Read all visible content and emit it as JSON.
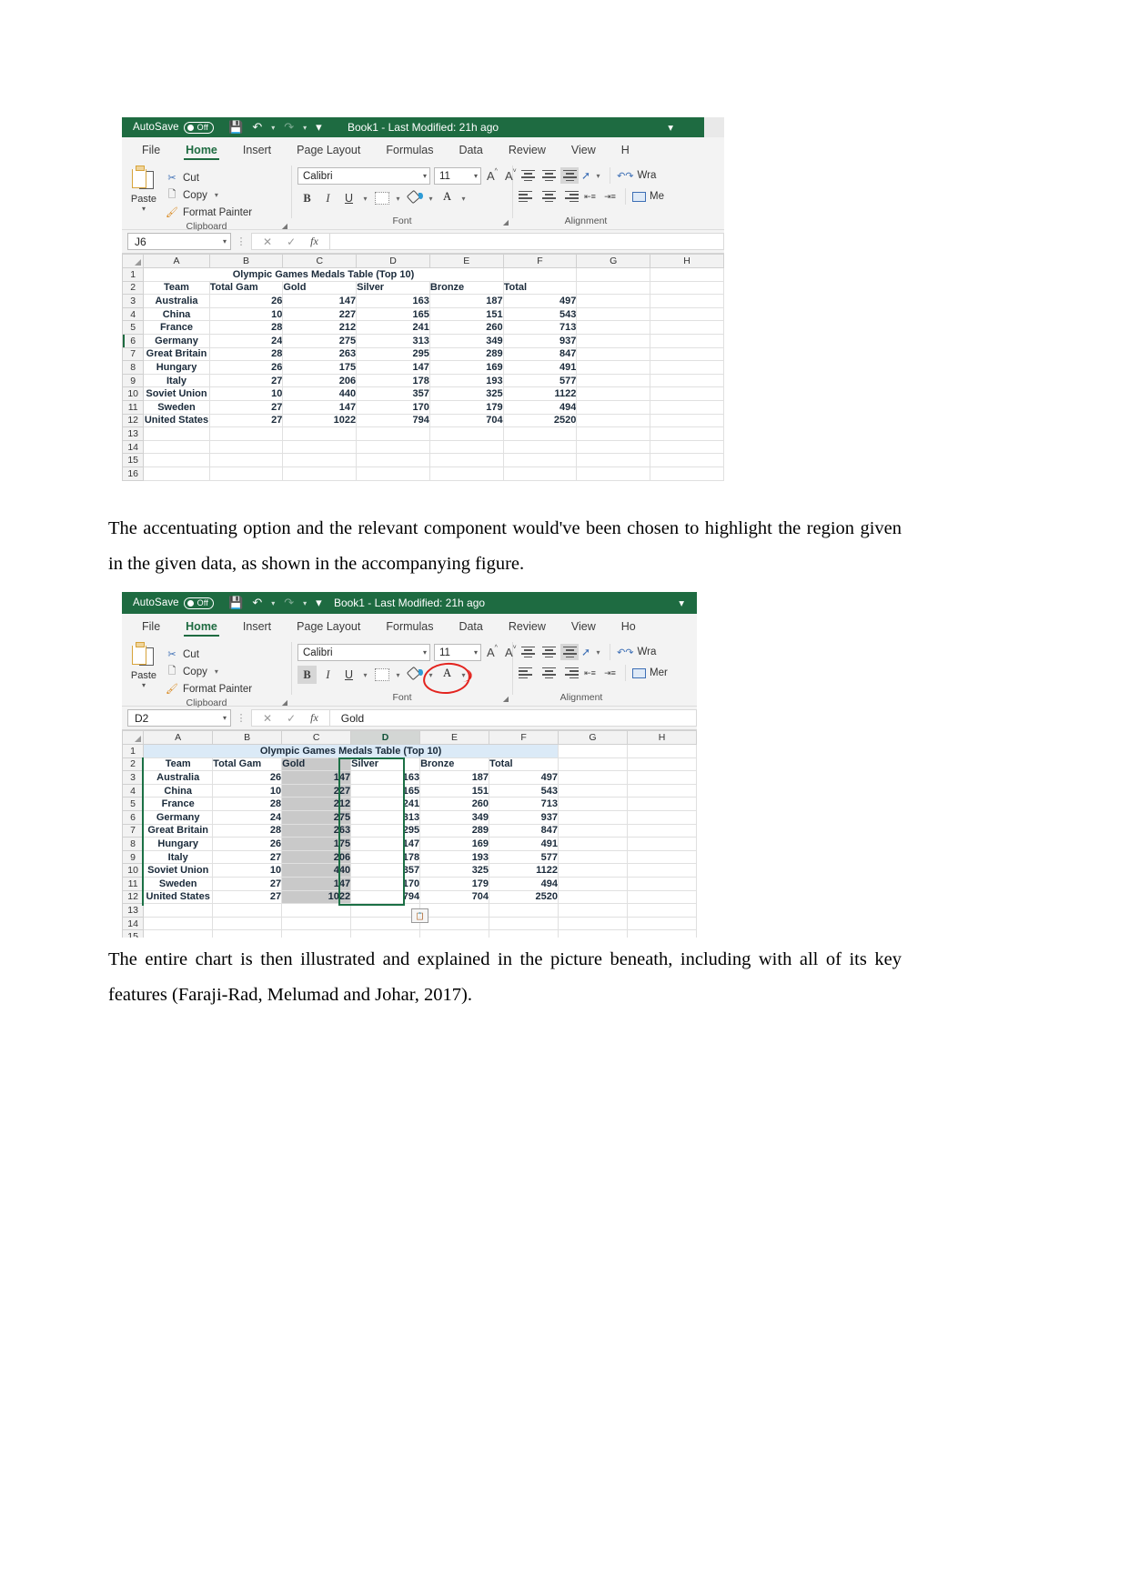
{
  "document": {
    "paragraph_1": "The accentuating option and the relevant component would've been chosen to highlight the region given in the given data, as shown in the accompanying figure.",
    "paragraph_2": "The entire chart is then illustrated and explained in the picture beneath, including with all of its key features (Faraji-Rad, Melumad and Johar, 2017)."
  },
  "excel": {
    "titlebar": {
      "autosave_label": "AutoSave",
      "autosave_state": "Off",
      "document_title": "Book1  -  Last Modified: 21h ago",
      "save_icon": "save-icon",
      "undo_icon": "undo-icon",
      "redo_icon": "redo-icon",
      "customize_icon": "customize-quick-access-icon"
    },
    "tabs": [
      {
        "label": "File",
        "active": false
      },
      {
        "label": "Home",
        "active": true
      },
      {
        "label": "Insert",
        "active": false
      },
      {
        "label": "Page Layout",
        "active": false
      },
      {
        "label": "Formulas",
        "active": false
      },
      {
        "label": "Data",
        "active": false
      },
      {
        "label": "Review",
        "active": false
      },
      {
        "label": "View",
        "active": false
      },
      {
        "label": "H",
        "active": false
      }
    ],
    "tabs_2": [
      {
        "label": "File",
        "active": false
      },
      {
        "label": "Home",
        "active": true
      },
      {
        "label": "Insert",
        "active": false
      },
      {
        "label": "Page Layout",
        "active": false
      },
      {
        "label": "Formulas",
        "active": false
      },
      {
        "label": "Data",
        "active": false
      },
      {
        "label": "Review",
        "active": false
      },
      {
        "label": "View",
        "active": false
      },
      {
        "label": "Ho",
        "active": false
      }
    ],
    "ribbon": {
      "clipboard": {
        "group_label": "Clipboard",
        "paste_label": "Paste",
        "cut_label": "Cut",
        "copy_label": "Copy",
        "format_painter_label": "Format Painter"
      },
      "font": {
        "group_label": "Font",
        "font_name": "Calibri",
        "font_size": "11",
        "increase_font_label": "A",
        "decrease_font_label": "A",
        "bold_label": "B",
        "italic_label": "I",
        "underline_label": "U",
        "borders_name": "borders-icon",
        "fill_color_name": "fill-color-icon",
        "font_color_label": "A",
        "font_color_hex": "#e11b22"
      },
      "alignment": {
        "group_label": "Alignment",
        "wrap_text_label": "Wra",
        "merge_label": "Me",
        "merge_label_2": "Mer",
        "wrap_text_label_2": "Wra",
        "orientation_name": "orientation-icon"
      }
    },
    "formula_bar_1": {
      "name_box": "J6",
      "cancel_icon": "cancel-icon",
      "enter_icon": "confirm-icon",
      "fx_label": "fx",
      "formula_value": ""
    },
    "formula_bar_2": {
      "name_box": "D2",
      "cancel_icon": "cancel-icon",
      "enter_icon": "confirm-icon",
      "fx_label": "fx",
      "formula_value": "Gold"
    },
    "sheet": {
      "column_headers": [
        "A",
        "B",
        "C",
        "D",
        "E",
        "F",
        "G",
        "H"
      ],
      "selected_column": "D",
      "title_row": "Olympic Games Medals Table (Top 10)",
      "header_row": [
        "Team",
        "Total Gam",
        "Gold",
        "Silver",
        "Bronze",
        "Total"
      ],
      "rows": [
        {
          "row": "3",
          "team": "Australia",
          "games": "26",
          "gold": "147",
          "silver": "163",
          "bronze": "187",
          "total": "497"
        },
        {
          "row": "4",
          "team": "China",
          "games": "10",
          "gold": "227",
          "silver": "165",
          "bronze": "151",
          "total": "543"
        },
        {
          "row": "5",
          "team": "France",
          "games": "28",
          "gold": "212",
          "silver": "241",
          "bronze": "260",
          "total": "713"
        },
        {
          "row": "6",
          "team": "Germany",
          "games": "24",
          "gold": "275",
          "silver": "313",
          "bronze": "349",
          "total": "937"
        },
        {
          "row": "7",
          "team": "Great Britain",
          "games": "28",
          "gold": "263",
          "silver": "295",
          "bronze": "289",
          "total": "847"
        },
        {
          "row": "8",
          "team": "Hungary",
          "games": "26",
          "gold": "175",
          "silver": "147",
          "bronze": "169",
          "total": "491"
        },
        {
          "row": "9",
          "team": "Italy",
          "games": "27",
          "gold": "206",
          "silver": "178",
          "bronze": "193",
          "total": "577"
        },
        {
          "row": "10",
          "team": "Soviet Union",
          "games": "10",
          "gold": "440",
          "silver": "357",
          "bronze": "325",
          "total": "1122"
        },
        {
          "row": "11",
          "team": "Sweden",
          "games": "27",
          "gold": "147",
          "silver": "170",
          "bronze": "179",
          "total": "494"
        },
        {
          "row": "12",
          "team": "United States",
          "games": "27",
          "gold": "1022",
          "silver": "794",
          "bronze": "704",
          "total": "2520"
        }
      ],
      "empty_rows_1": [
        "13",
        "14",
        "15",
        "16"
      ],
      "empty_rows_2": [
        "13",
        "14",
        "15"
      ],
      "row_label_1": "1",
      "row_label_2": "2"
    },
    "annotation": {
      "circle_target": "fill-color-button",
      "circle_color": "#e3241f"
    }
  }
}
